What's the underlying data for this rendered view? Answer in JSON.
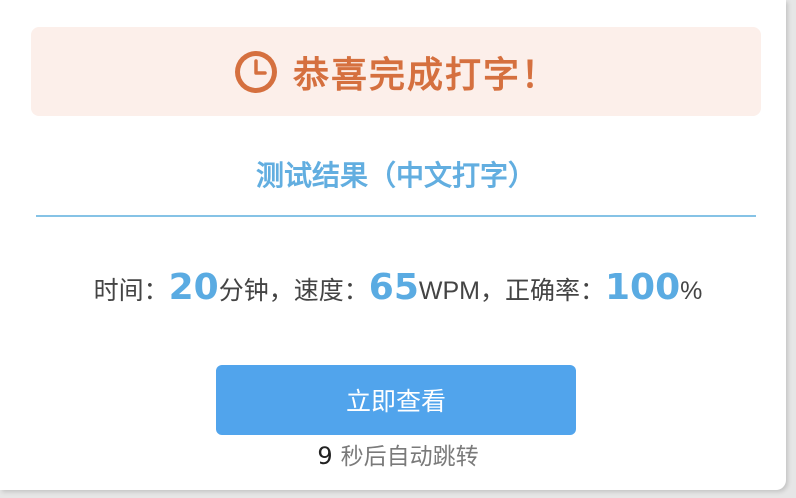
{
  "banner": {
    "title": "恭喜完成打字！",
    "icon": "clock-icon",
    "accent_color": "#d5703f",
    "background_color": "#fcefea"
  },
  "result": {
    "title": "测试结果（中文打字）",
    "title_color": "#62aee0"
  },
  "stats": {
    "time_label": "时间：",
    "time_value": "20",
    "time_unit": "分钟，",
    "speed_label": "速度：",
    "speed_value": "65",
    "speed_unit": "WPM，",
    "accuracy_label": "正确率：",
    "accuracy_value": "100",
    "accuracy_unit": "%",
    "value_color": "#5aabe2"
  },
  "actions": {
    "view_label": "立即查看",
    "button_color": "#51a4ec"
  },
  "redirect": {
    "countdown": "9",
    "text": "秒后自动跳转"
  }
}
